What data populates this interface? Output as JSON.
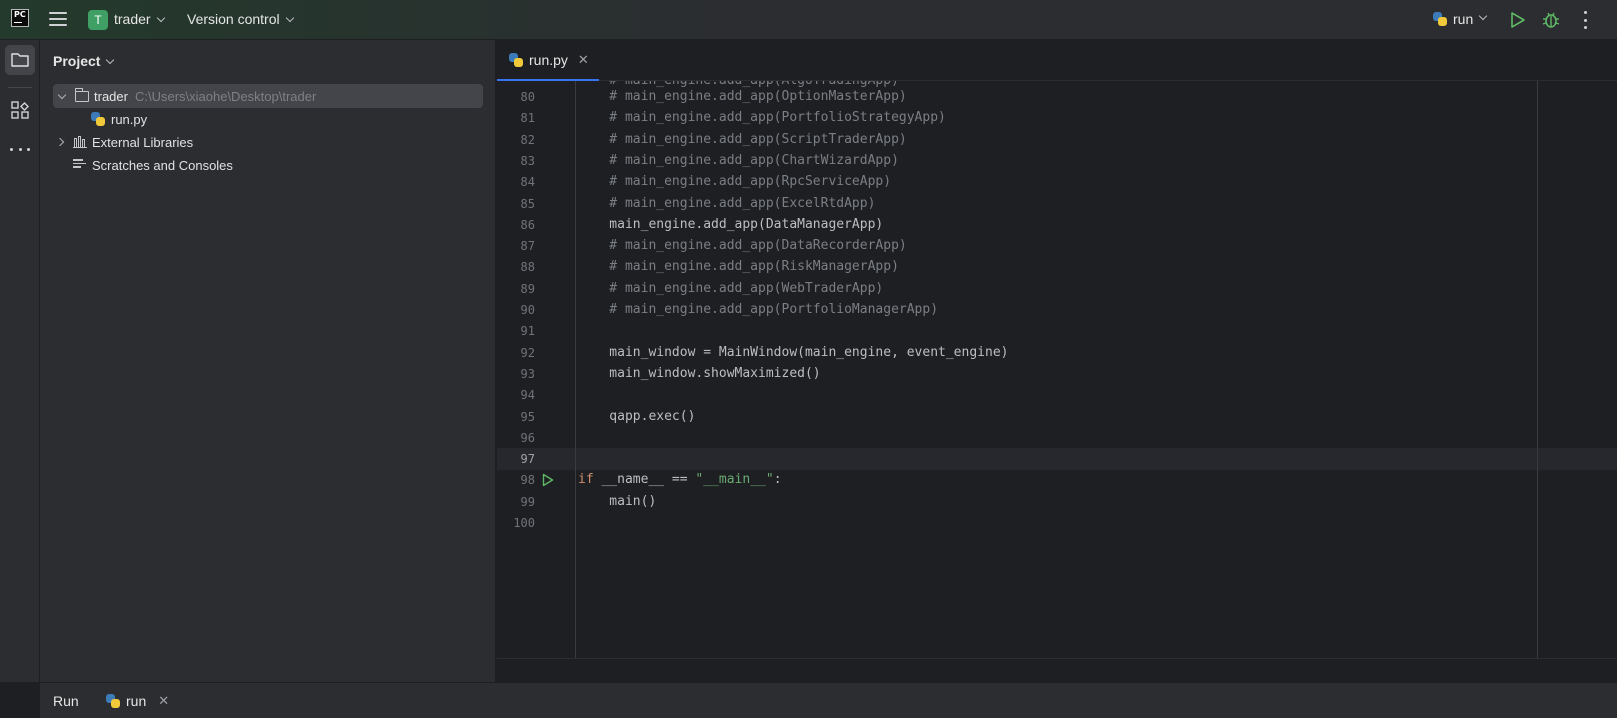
{
  "titlebar": {
    "logo_text": "PC",
    "project_badge": "T",
    "project_name": "trader",
    "vcs_label": "Version control",
    "run_config": "run"
  },
  "project_panel": {
    "header": "Project",
    "tree": [
      {
        "name": "trader",
        "path": "C:\\Users\\xiaohe\\Desktop\\trader"
      },
      {
        "name": "run.py"
      },
      {
        "name": "External Libraries"
      },
      {
        "name": "Scratches and Consoles"
      }
    ]
  },
  "editor": {
    "tab_label": "run.py",
    "lines": [
      {
        "n": "80",
        "text": "    # main_engine.add_app(OptionMasterApp)",
        "type": "comment"
      },
      {
        "n": "81",
        "text": "    # main_engine.add_app(PortfolioStrategyApp)",
        "type": "comment"
      },
      {
        "n": "82",
        "text": "    # main_engine.add_app(ScriptTraderApp)",
        "type": "comment"
      },
      {
        "n": "83",
        "text": "    # main_engine.add_app(ChartWizardApp)",
        "type": "comment"
      },
      {
        "n": "84",
        "text": "    # main_engine.add_app(RpcServiceApp)",
        "type": "comment"
      },
      {
        "n": "85",
        "text": "    # main_engine.add_app(ExcelRtdApp)",
        "type": "comment"
      },
      {
        "n": "86",
        "text": "    main_engine.add_app(DataManagerApp)",
        "type": "code"
      },
      {
        "n": "87",
        "text": "    # main_engine.add_app(DataRecorderApp)",
        "type": "comment"
      },
      {
        "n": "88",
        "text": "    # main_engine.add_app(RiskManagerApp)",
        "type": "comment"
      },
      {
        "n": "89",
        "text": "    # main_engine.add_app(WebTraderApp)",
        "type": "comment"
      },
      {
        "n": "90",
        "text": "    # main_engine.add_app(PortfolioManagerApp)",
        "type": "comment"
      },
      {
        "n": "91",
        "text": "",
        "type": "code"
      },
      {
        "n": "92",
        "text": "    main_window = MainWindow(main_engine, event_engine)",
        "type": "code"
      },
      {
        "n": "93",
        "text": "    main_window.showMaximized()",
        "type": "code"
      },
      {
        "n": "94",
        "text": "",
        "type": "code"
      },
      {
        "n": "95",
        "text": "    qapp.exec()",
        "type": "code"
      },
      {
        "n": "96",
        "text": "",
        "type": "code"
      },
      {
        "n": "97",
        "text": "",
        "type": "code"
      },
      {
        "n": "98",
        "kw": "if",
        "mid": " __name__ == ",
        "str": "\"__main__\"",
        "tail": ":",
        "type": "main"
      },
      {
        "n": "99",
        "text": "    main()",
        "type": "code"
      },
      {
        "n": "100",
        "text": "",
        "type": "code"
      }
    ],
    "active_line": "97"
  },
  "runbar": {
    "title": "Run",
    "tab_label": "run"
  },
  "colors": {
    "accent": "#3574f0",
    "badge": "#3f9f65",
    "run_green": "#5fb865"
  }
}
